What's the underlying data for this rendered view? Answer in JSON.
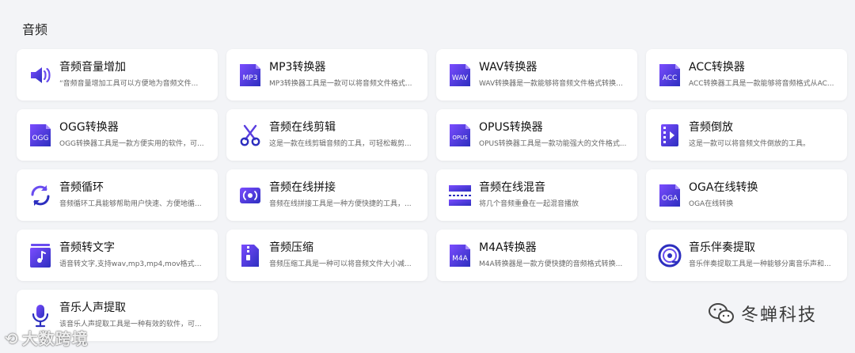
{
  "section_title": "音频",
  "cards": [
    {
      "title": "音频音量增加",
      "desc": "“音频音量增加工具可以方便地为音频文件...",
      "icon": "speaker-volume-icon"
    },
    {
      "title": "MP3转换器",
      "desc": "MP3转换器工具是一款可以将音频文件格式...",
      "icon": "mp3-file-icon",
      "badge": "MP3"
    },
    {
      "title": "WAV转换器",
      "desc": "WAV转换器是一款能够将音频文件格式转换...",
      "icon": "wav-file-icon",
      "badge": "WAV"
    },
    {
      "title": "ACC转换器",
      "desc": "ACC转换器工具是一款能够将音频格式从AC...",
      "icon": "acc-file-icon",
      "badge": "ACC"
    },
    {
      "title": "OGG转换器",
      "desc": "OGG转换器工具是一款方便实用的软件，可...",
      "icon": "ogg-file-icon",
      "badge": "OGG"
    },
    {
      "title": "音频在线剪辑",
      "desc": "这是一款在线剪辑音频的工具，可轻松裁剪...",
      "icon": "scissors-icon"
    },
    {
      "title": "OPUS转换器",
      "desc": "OPUS转换器工具是一款功能强大的文件格式...",
      "icon": "opus-file-icon",
      "badge": "OPUS"
    },
    {
      "title": "音频倒放",
      "desc": "这是一款可以将音频文件倒放的工具。",
      "icon": "film-reverse-icon"
    },
    {
      "title": "音频循环",
      "desc": "音频循环工具能够帮助用户快速、方便地循...",
      "icon": "loop-arrows-icon"
    },
    {
      "title": "音频在线拼接",
      "desc": "音频在线拼接工具是一种方便快捷的工具，...",
      "icon": "audio-merge-icon"
    },
    {
      "title": "音频在线混音",
      "desc": "将几个音频重叠在一起混音播放",
      "icon": "audio-mix-icon"
    },
    {
      "title": "OGA在线转换",
      "desc": "OGA在线转换",
      "icon": "oga-file-icon",
      "badge": "OGA"
    },
    {
      "title": "音频转文字",
      "desc": "语音转文字,支持wav,mp3,mp4,mov格式中...",
      "icon": "music-note-doc-icon"
    },
    {
      "title": "音频压缩",
      "desc": "音频压缩工具是一种可以将音频文件大小减...",
      "icon": "zip-file-icon"
    },
    {
      "title": "M4A转换器",
      "desc": "M4A转换器是一款方便快捷的音频格式转换...",
      "icon": "m4a-file-icon",
      "badge": "M4A"
    },
    {
      "title": "音乐伴奏提取",
      "desc": "音乐伴奏提取工具是一种能够分离音乐声和...",
      "icon": "vinyl-disc-icon"
    },
    {
      "title": "音乐人声提取",
      "desc": "该音乐人声提取工具是一种有效的软件，可...",
      "icon": "microphone-icon"
    }
  ],
  "watermark_left": "大数跨境",
  "watermark_right": "冬蝉科技",
  "colors": {
    "accent_dark": "#2d2fbf",
    "accent_light": "#7b4cff",
    "background": "#f3f4f7"
  }
}
